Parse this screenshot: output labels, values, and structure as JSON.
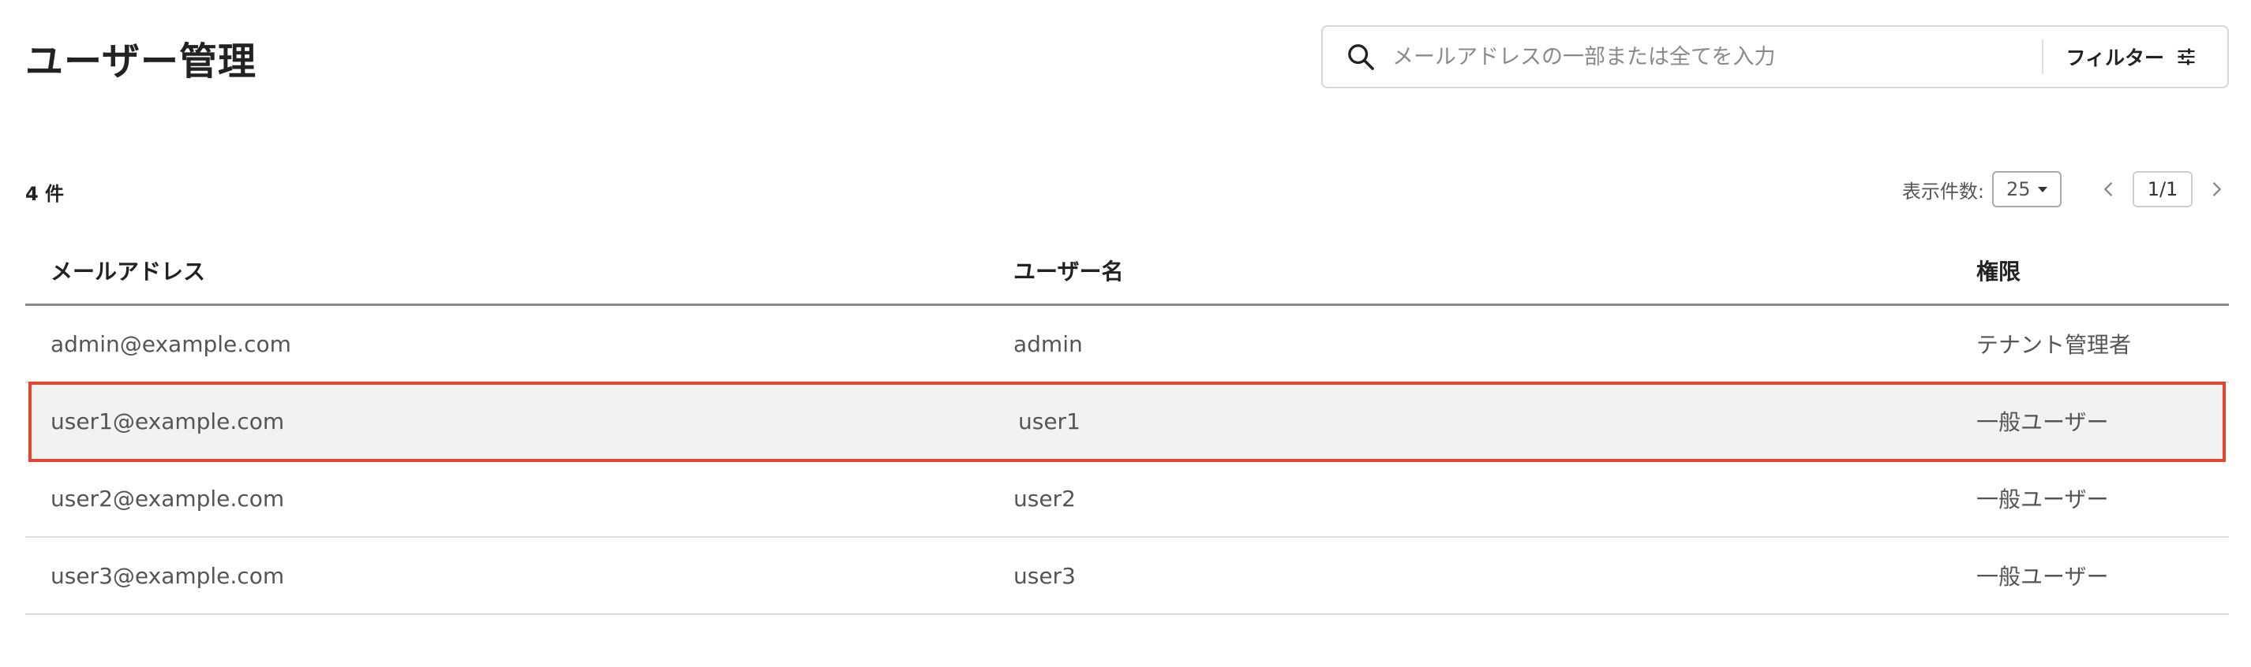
{
  "page": {
    "title": "ユーザー管理"
  },
  "search": {
    "placeholder": "メールアドレスの一部または全てを入力",
    "value": "",
    "filter_label": "フィルター"
  },
  "results": {
    "count_label": "4 件"
  },
  "pagination": {
    "per_page_label": "表示件数:",
    "per_page_value": "25",
    "page_indicator": "1/1"
  },
  "table": {
    "headers": {
      "email": "メールアドレス",
      "name": "ユーザー名",
      "role": "権限"
    },
    "rows": [
      {
        "email": "admin@example.com",
        "name": "admin",
        "role": "テナント管理者"
      },
      {
        "email": "user1@example.com",
        "name": "user1",
        "role": "一般ユーザー"
      },
      {
        "email": "user2@example.com",
        "name": "user2",
        "role": "一般ユーザー"
      },
      {
        "email": "user3@example.com",
        "name": "user3",
        "role": "一般ユーザー"
      }
    ]
  },
  "colors": {
    "selection_outline": "#e3452f",
    "selected_row_bg": "#f2f2f2"
  },
  "icons": {
    "search": "search-icon",
    "filter": "sliders-icon",
    "prev": "chevron-left-icon",
    "next": "chevron-right-icon",
    "dropdown": "caret-down-icon"
  }
}
